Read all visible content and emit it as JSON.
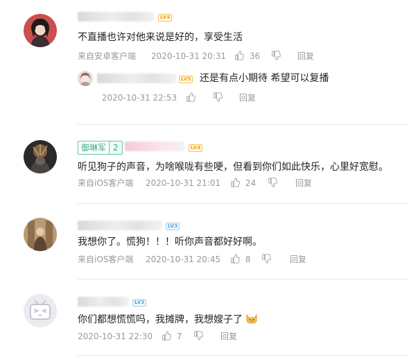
{
  "comments": [
    {
      "level": "LV4",
      "text": "不直播也许对他来说是好的，享受生活",
      "source": "来自安卓客户端",
      "time": "2020-10-31 20:31",
      "likes": "36",
      "reply_label": "回复",
      "sub_reply": {
        "level": "LV5",
        "text": "还是有点小期待 希望可以复播",
        "time": "2020-10-31 22:53",
        "reply_label": "回复"
      }
    },
    {
      "fan_badge_name": "御琳军",
      "fan_badge_level": "2",
      "level": "LV4",
      "text": "听见狗子的声音，为啥喉咙有些哽，但看到你们如此快乐，心里好宽慰。",
      "source": "来自iOS客户端",
      "time": "2020-10-31 21:01",
      "likes": "24",
      "reply_label": "回复"
    },
    {
      "level": "LV3",
      "text": "我想你了。慌狗！！！听你声音都好好啊。",
      "source": "来自iOS客户端",
      "time": "2020-10-31 20:45",
      "likes": "8",
      "reply_label": "回复"
    },
    {
      "level": "LV3",
      "text": "你们都想慌慌吗，我摊牌，我想嫂子了",
      "time": "2020-10-31 22:30",
      "likes": "7",
      "reply_label": "回复"
    }
  ],
  "icons": {
    "like": "thumbs-up-icon",
    "dislike": "thumbs-down-icon",
    "emoji": "cat-face-emoji-icon",
    "default_avatar": "tv-face-avatar-icon"
  },
  "colors": {
    "meta_text": "#999999",
    "level_orange": "#f4a000",
    "level_blue": "#46a8e0",
    "fan_badge": "#3aa886"
  }
}
